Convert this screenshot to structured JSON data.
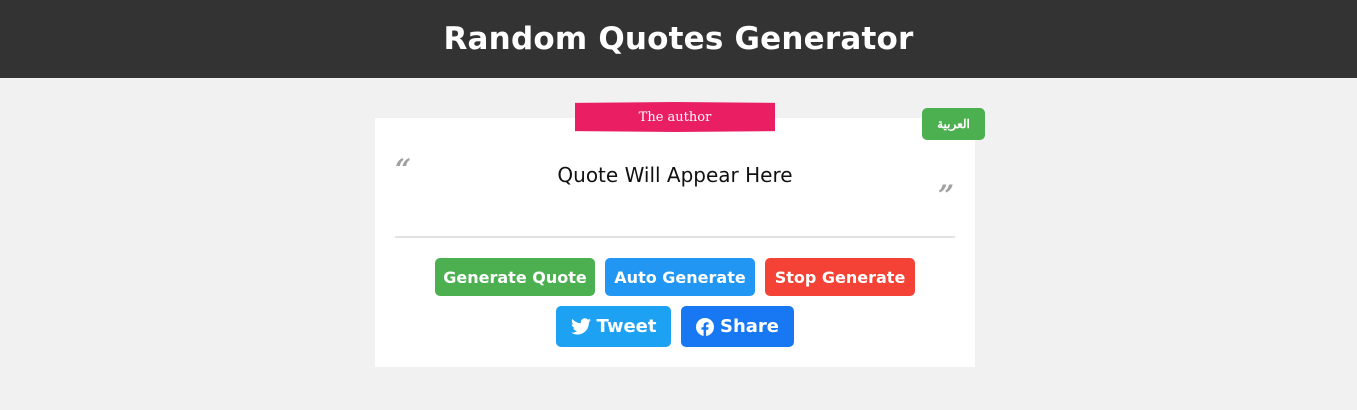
{
  "header": {
    "title": "Random Quotes Generator"
  },
  "author": {
    "label": "The author"
  },
  "language_toggle": {
    "label": "العربية"
  },
  "quote": {
    "open_mark": "“",
    "text": "Quote Will Appear Here",
    "close_mark": "”"
  },
  "actions": {
    "generate_label": "Generate Quote",
    "auto_label": "Auto Generate",
    "stop_label": "Stop Generate"
  },
  "social": {
    "tweet_label": "Tweet",
    "tweet_icon": "twitter-icon",
    "share_label": "Share",
    "share_icon": "facebook-icon"
  },
  "colors": {
    "header_bg": "#333333",
    "author_ribbon": "#e91e63",
    "generate": "#4caf50",
    "auto": "#2196f3",
    "stop": "#f44336",
    "tweet": "#1da1f2",
    "share": "#1877f2"
  }
}
